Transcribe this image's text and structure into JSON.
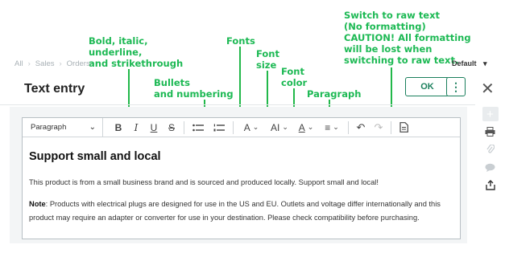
{
  "annotations": {
    "bold": "Bold, italic,\nunderline,\nand strikethrough",
    "bullets": "Bullets\nand numbering",
    "fonts": "Fonts",
    "font_size": "Font\nsize",
    "font_color": "Font\ncolor",
    "paragraph": "Paragraph",
    "raw_text": "Switch to raw text\n(No formatting)\nCAUTION! All formatting\nwill be lost when\nswitching to raw text."
  },
  "breadcrumb": [
    "All",
    "Sales",
    "Orders"
  ],
  "preset": "Default",
  "header": {
    "title": "Text entry",
    "ok_label": "OK",
    "more_label": "⋮",
    "close_label": "✕"
  },
  "toolbar": {
    "paragraph_select": "Paragraph",
    "bold": "B",
    "italic": "I",
    "underline": "U",
    "strike": "S",
    "font": "A",
    "font_size": "AI",
    "font_color": "A",
    "align": "≡"
  },
  "content": {
    "heading": "Support small and local",
    "paragraph1": "This product is from a small business brand and is sourced and produced locally. Support small and local!",
    "note_label": "Note",
    "note_text": ": Products with electrical plugs are designed for use in the US and EU. Outlets and voltage differ internationally and this product may require an adapter or converter for use in your destination. Please check compatibility before purchasing."
  },
  "sidebar": {
    "icons": [
      "add-icon",
      "printer-icon",
      "paperclip-icon",
      "comment-icon",
      "share-icon"
    ]
  },
  "colors": {
    "annotation": "#22b84a",
    "accent": "#1a7f5c"
  }
}
